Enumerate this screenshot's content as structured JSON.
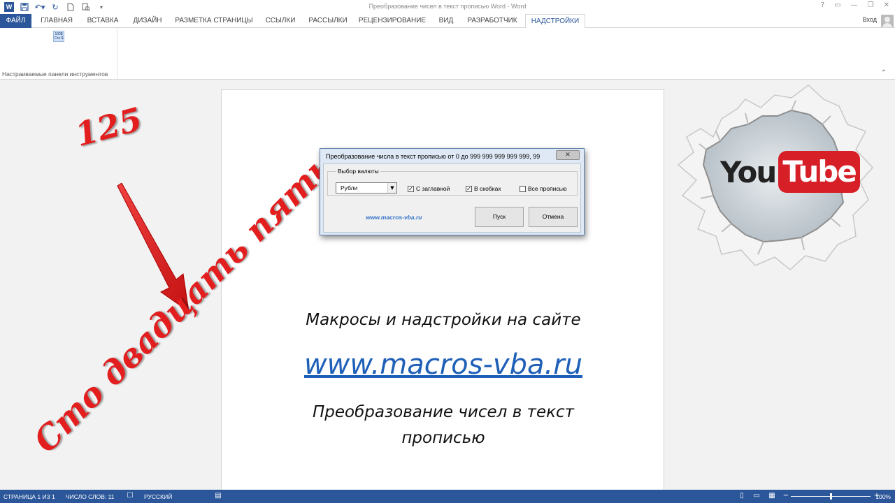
{
  "window": {
    "title": "Преобразование чисел в текст прописью Word - Word",
    "controls": [
      "?",
      "▭",
      "—",
      "❐",
      "✕"
    ]
  },
  "qat": {
    "icons": [
      "save-icon",
      "undo-icon",
      "redo-icon",
      "new-document-icon",
      "print-preview-icon",
      "customize-icon"
    ],
    "app_badge": "W"
  },
  "tabs": [
    {
      "label": "ФАЙЛ"
    },
    {
      "label": "ГЛАВНАЯ"
    },
    {
      "label": "ВСТАВКА"
    },
    {
      "label": "ДИЗАЙН"
    },
    {
      "label": "РАЗМЕТКА СТРАНИЦЫ"
    },
    {
      "label": "ССЫЛКИ"
    },
    {
      "label": "РАССЫЛКИ"
    },
    {
      "label": "РЕЦЕНЗИРОВАНИЕ"
    },
    {
      "label": "ВИД"
    },
    {
      "label": "РАЗРАБОТЧИК"
    },
    {
      "label": "НАДСТРОЙКИ"
    }
  ],
  "active_tab": "НАДСТРОЙКИ",
  "account": {
    "login_label": "Вход"
  },
  "ribbon": {
    "group_label": "Настраиваемые панели инструментов",
    "icon_text_top": "100$",
    "icon_text_bottom": "Сто $"
  },
  "document": {
    "line1": "Макросы и надстройки на сайте",
    "link": "www.macros-vba.ru",
    "line3a": "Преобразование чисел в текст",
    "line3b": "прописью"
  },
  "dialog": {
    "title": "Преобразование числа в текст прописью от 0 до 999 999 999 999 999, 99",
    "close_label": "✕",
    "group_label": "Выбор валюты",
    "currency_selected": "Рубли",
    "checkboxes": [
      {
        "label": "С заглавной",
        "checked": true
      },
      {
        "label": "В скобках",
        "checked": true
      },
      {
        "label": "Все прописью",
        "checked": false
      }
    ],
    "site_link": "www.macros-vba.ru",
    "run_label": "Пуск",
    "cancel_label": "Отмена"
  },
  "overlay": {
    "number": "125",
    "words": "Сто двадцать пять",
    "accent_color": "#e31e1e"
  },
  "youtube": {
    "part1": "You",
    "part2": "Tube"
  },
  "statusbar": {
    "page": "СТРАНИЦА 1 ИЗ 1",
    "words": "ЧИСЛО СЛОВ: 11",
    "language": "РУССКИЙ",
    "zoom": "100%",
    "zoom_level": 1.0
  },
  "colors": {
    "brand": "#2b579a",
    "link": "#1e5fb8"
  }
}
